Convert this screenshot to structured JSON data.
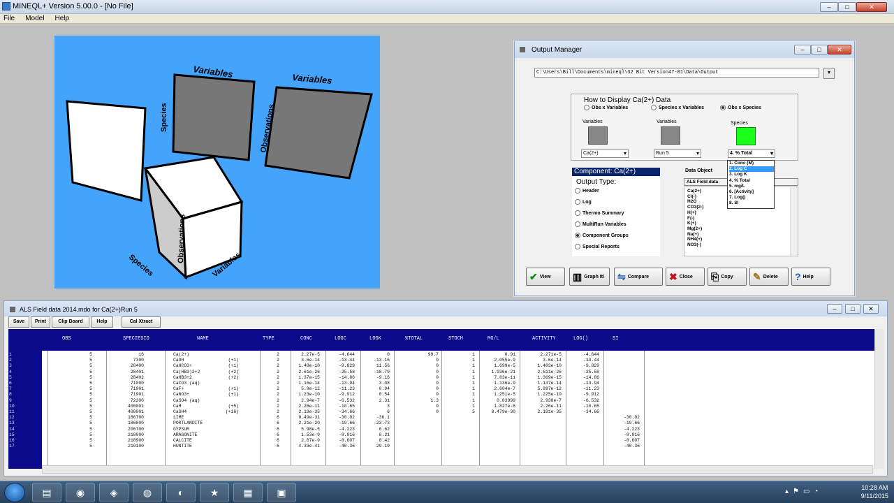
{
  "app": {
    "title": "MINEQL+ Version 5.00.0 - [No File]"
  },
  "menu": {
    "items": [
      "File",
      "Model",
      "Help"
    ]
  },
  "cube": {
    "labels": {
      "variables_top1": "Variables",
      "variables_top2": "Variables",
      "species_left": "Species",
      "observations_right": "Observations",
      "observations_cube": "Observations",
      "species_bottom": "Species",
      "variables_bottom": "Variables"
    },
    "bg": "#44a3fb"
  },
  "output_manager": {
    "title": "Output Manager",
    "path": "C:\\Users\\Bill\\Documents\\mineql\\32 Bit Version47-01\\Data\\Output",
    "how_display": "How to Display Ca(2+) Data",
    "options": [
      "Obs x Variables",
      "Species x Variables",
      "Obs x Species"
    ],
    "selected_option": "Obs x Species",
    "col1_label": "Variables",
    "col2_label": "Variables",
    "col3_label": "Species",
    "combo1": "Ca(2+)",
    "combo2": "Run 5",
    "combo3": "4. % Total",
    "dropdown": [
      "1. Conc (M)",
      "2. Log C",
      "3. Log K",
      "4. % Total",
      "5. mg/L",
      "6. [Activity]",
      "7. Log()",
      "8. SI"
    ],
    "dropdown_selected_index": 1,
    "component_header": "Component: Ca(2+)",
    "output_type_label": "Output Type:",
    "output_types": [
      "Header",
      "Log",
      "Thermo Summary",
      "MultiRun Variables",
      "Component Groups",
      "Special Reports"
    ],
    "output_type_selected": "Component Groups",
    "data_object_label": "Data Object",
    "data_object_value": "ALS Field data",
    "data_list": [
      "Ca(2+)",
      "Cl(-)",
      "H2O",
      "CO3(2-)",
      "H(+)",
      "F(-)",
      "K(+)",
      "Mg(2+)",
      "Na(+)",
      "NH4(+)",
      "NO3(-)"
    ],
    "buttons": [
      {
        "label": "View",
        "icon": "✔"
      },
      {
        "label": "Graph It!",
        "icon": "▥"
      },
      {
        "label": "Compare",
        "icon": "⇋"
      },
      {
        "label": "Close",
        "icon": "✖"
      },
      {
        "label": "Copy",
        "icon": "⎘"
      },
      {
        "label": "Delete",
        "icon": "✎"
      },
      {
        "label": "Help",
        "icon": "?"
      }
    ]
  },
  "data_window": {
    "title": "ALS Field data 2014.mdo for Ca(2+)Run 5",
    "toolbar": [
      "Save",
      "Print",
      "Clip Board",
      "Help",
      "Cal Xtract"
    ],
    "columns": [
      "OBS",
      "SPECIESID",
      "NAME",
      "TYPE",
      "CONC",
      "LOGC",
      "LOGK",
      "%TOTAL",
      "STOCH",
      "MG/L",
      "ACTIVITY",
      "LOG()",
      "SI"
    ],
    "row_numbers": [
      "1",
      "2",
      "3",
      "4",
      "5",
      "6",
      "7",
      "8",
      "9",
      "10",
      "11",
      "12",
      "13",
      "14",
      "15",
      "16",
      "17"
    ],
    "rows": [
      [
        "5",
        "16",
        "Ca(2+)",
        "",
        "2",
        "2.27e-5",
        "-4.644",
        "0",
        "99.7",
        "1",
        "0.91",
        "2.271e-5",
        "-4.644",
        ""
      ],
      [
        "5",
        "7300",
        "CaOH",
        "(+1)",
        "2",
        "3.6e-14",
        "-13.44",
        "-13.16",
        "0",
        "1",
        "2.055e-9",
        "3.6e-14",
        "-13.44",
        ""
      ],
      [
        "5",
        "28400",
        "CaHCO3+",
        "(+1)",
        "2",
        "1.48e-10",
        "-9.829",
        "11.56",
        "0",
        "1",
        "1.699e-5",
        "1.483e-10",
        "-9.829",
        ""
      ],
      [
        "5",
        "28401",
        "Ca(HB3)2+2",
        "(+2)",
        "2",
        "2.61e-26",
        "-25.58",
        "-18.79",
        "0",
        "1",
        "1.936e-21",
        "2.611e-26",
        "-25.58",
        ""
      ],
      [
        "5",
        "28402",
        "CaHB3+2",
        "(+2)",
        "2",
        "1.37e-15",
        "-14.86",
        "-9.16",
        "0",
        "1",
        "7.83e-11",
        "1.369e-15",
        "-14.86",
        ""
      ],
      [
        "5",
        "71000",
        "CaCO3 (aq)",
        "",
        "2",
        "1.16e-14",
        "-13.94",
        "3.08",
        "0",
        "1",
        "1.136e-9",
        "1.137e-14",
        "-13.94",
        ""
      ],
      [
        "5",
        "71901",
        "CaF+",
        "(+1)",
        "2",
        "5.9e-12",
        "-11.23",
        "0.94",
        "0",
        "1",
        "2.604e-7",
        "5.897e-12",
        "-11.23",
        ""
      ],
      [
        "5",
        "71901",
        "CaNO3+",
        "(+1)",
        "2",
        "1.23e-10",
        "-9.912",
        "0.54",
        "0",
        "1",
        "1.251e-5",
        "1.225e-10",
        "-9.912",
        ""
      ],
      [
        "5",
        "72300",
        "CaSO4 (aq)",
        "",
        "2",
        "2.94e-7",
        "-6.532",
        "2.31",
        "1.3",
        "1",
        "0.03999",
        "2.938e-7",
        "-6.532",
        ""
      ],
      [
        "5",
        "400001",
        "CaH",
        "(+5)",
        "2",
        "2.26e-11",
        "-10.65",
        "3",
        "0",
        "1",
        "1.827e-6",
        "2.26e-11",
        "-10.65",
        ""
      ],
      [
        "5",
        "400001",
        "CaSH4",
        "(+16)",
        "2",
        "2.19e-35",
        "-34.66",
        "6",
        "0",
        "5",
        "8.479e-30",
        "2.191e-35",
        "-34.66",
        ""
      ],
      [
        "5",
        "186700",
        "LIME",
        "",
        "6",
        "9.49e-31",
        "-30.02",
        "-36.1",
        "",
        "",
        "",
        "",
        "",
        "-30.02"
      ],
      [
        "5",
        "186800",
        "PORTLANDITE",
        "",
        "6",
        "2.21e-20",
        "-19.66",
        "-23.73",
        "",
        "",
        "",
        "",
        "",
        "-19.66"
      ],
      [
        "5",
        "206700",
        "GYPSUM",
        "",
        "6",
        "5.98e-5",
        "-4.223",
        "6.62",
        "",
        "",
        "",
        "",
        "",
        "-4.223"
      ],
      [
        "5",
        "218000",
        "ARAGONITE",
        "",
        "6",
        "1.53e-9",
        "-8.816",
        "8.21",
        "",
        "",
        "",
        "",
        "",
        "-8.816"
      ],
      [
        "5",
        "218900",
        "CALCITE",
        "",
        "6",
        "2.67e-9",
        "-8.607",
        "8.42",
        "",
        "",
        "",
        "",
        "",
        "-8.607"
      ],
      [
        "5",
        "219100",
        "HUNTITE",
        "",
        "6",
        "4.33e-41",
        "-40.36",
        "29.19",
        "",
        "",
        "",
        "",
        "",
        "-40.36"
      ]
    ]
  },
  "taskbar": {
    "time": "10:28 AM",
    "date": "9/11/2015"
  }
}
